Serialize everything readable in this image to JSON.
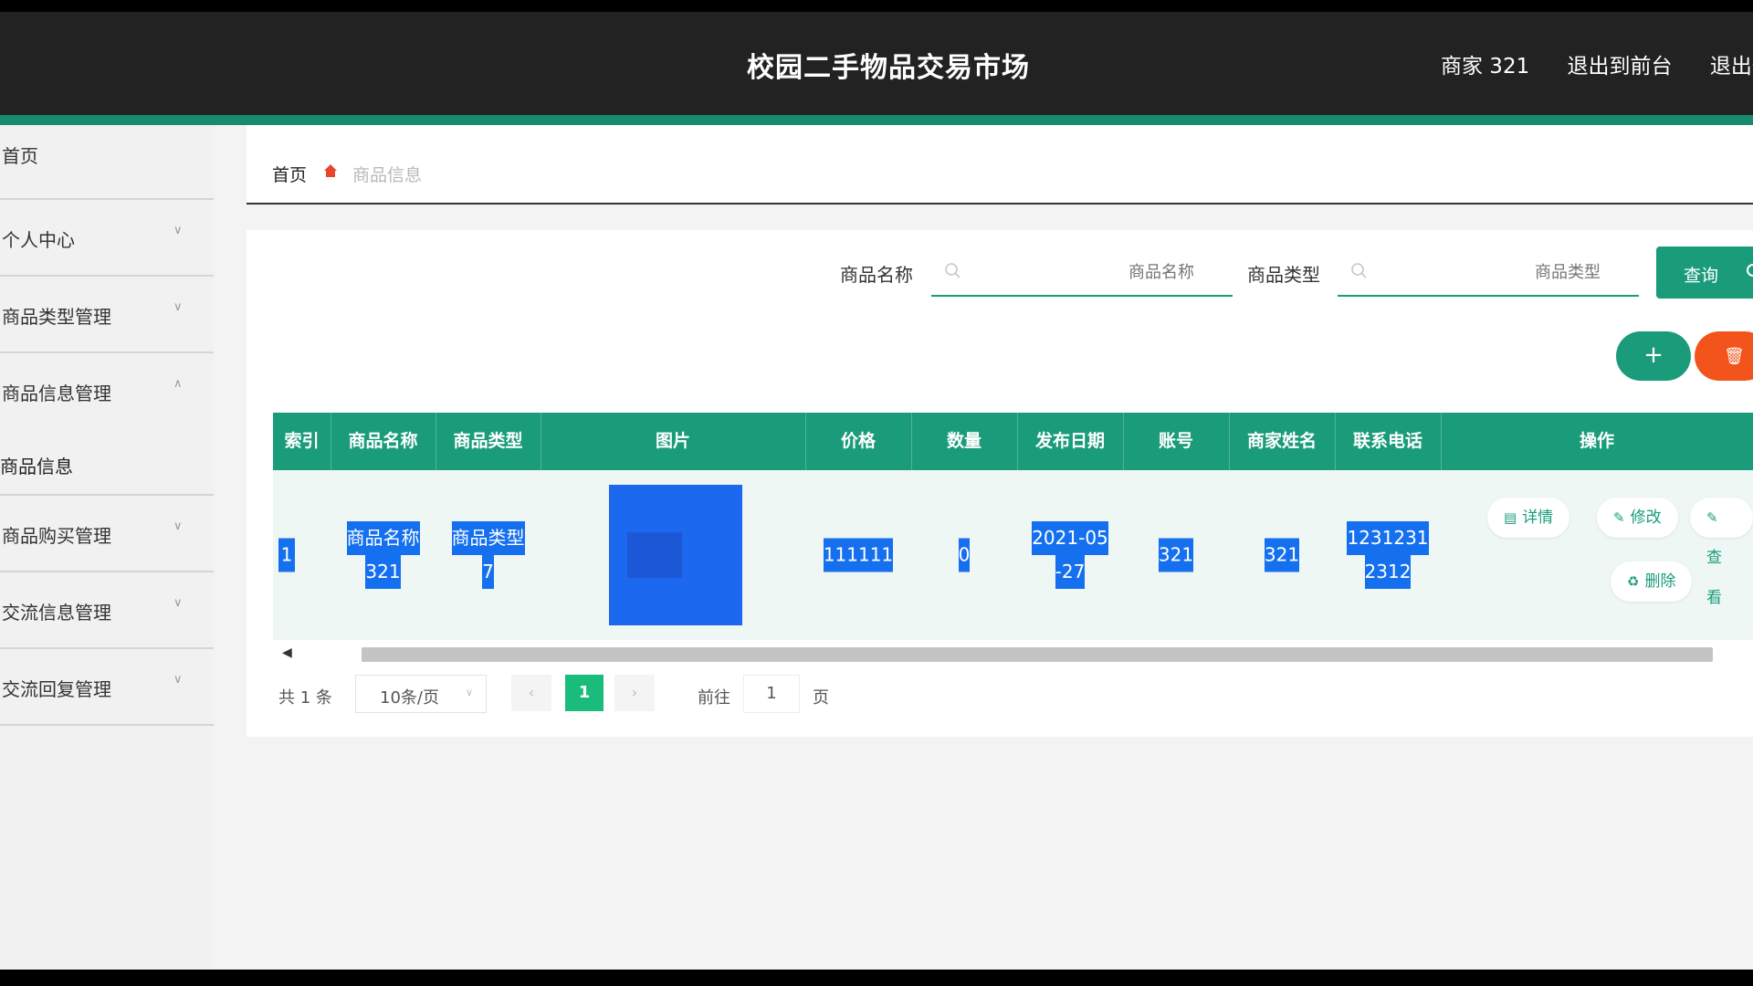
{
  "header": {
    "title": "校园二手物品交易市场",
    "user": "商家 321",
    "to_front": "退出到前台",
    "logout": "退出登录"
  },
  "sidebar": {
    "items": [
      {
        "label": "首页"
      },
      {
        "label": "个人中心"
      },
      {
        "label": "商品类型管理"
      },
      {
        "label": "商品信息管理"
      },
      {
        "label": "商品信息"
      },
      {
        "label": "商品购买管理"
      },
      {
        "label": "交流信息管理"
      },
      {
        "label": "交流回复管理"
      }
    ]
  },
  "breadcrumb": {
    "home": "首页",
    "current": "商品信息"
  },
  "search": {
    "name_label": "商品名称",
    "name_placeholder": "商品名称",
    "type_label": "商品类型",
    "type_placeholder": "商品类型",
    "query_button": "查询"
  },
  "actions": {
    "add": "+",
    "delete_icon": "trash-icon"
  },
  "table": {
    "headers": [
      "索引",
      "商品名称",
      "商品类型",
      "图片",
      "价格",
      "数量",
      "发布日期",
      "账号",
      "商家姓名",
      "联系电话",
      "操作"
    ],
    "rows": [
      {
        "index": "1",
        "name_line1": "商品名称",
        "name_line2": "321",
        "type_line1": "商品类型",
        "type_line2": "7",
        "price": "111111",
        "quantity": "0",
        "date_line1": "2021-05",
        "date_line2": "-27",
        "account": "321",
        "merchant": "321",
        "phone_line1": "1231231",
        "phone_line2": "2312",
        "ops": {
          "detail": "详情",
          "edit": "修改",
          "view": "查看",
          "delete": "删除"
        }
      }
    ]
  },
  "pagination": {
    "total": "共 1 条",
    "page_size": "10条/页",
    "current": "1",
    "goto_label": "前往",
    "goto_value": "1",
    "page_label": "页"
  },
  "colors": {
    "accent": "#1a9c7a",
    "danger": "#f2541b",
    "header_bg": "#222222"
  }
}
